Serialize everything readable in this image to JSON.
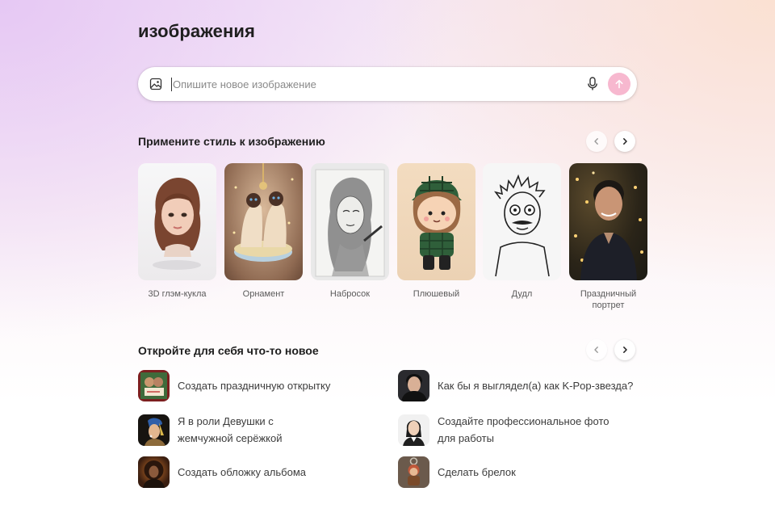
{
  "page": {
    "title": "изображения"
  },
  "prompt": {
    "placeholder": "Опишите новое изображение",
    "value": "",
    "icons": {
      "attach": "image-icon",
      "voice": "microphone-icon",
      "send": "arrow-up-icon"
    },
    "send_color": "#f7b8cf"
  },
  "styles_section": {
    "title": "Примените стиль к изображению",
    "prev": "chevron-left-icon",
    "next": "chevron-right-icon",
    "items": [
      {
        "label": "3D глэм-кукла"
      },
      {
        "label": "Орнамент"
      },
      {
        "label": "Набросок"
      },
      {
        "label": "Плюшевый"
      },
      {
        "label": "Дудл"
      },
      {
        "label": "Праздничный портрет"
      }
    ]
  },
  "discover_section": {
    "title": "Откройте для себя что-то новое",
    "prev": "chevron-left-icon",
    "next": "chevron-right-icon",
    "items": [
      {
        "label": "Создать праздничную открытку"
      },
      {
        "label": "Как бы я выглядел(а) как K-Pop-звезда?"
      },
      {
        "label": "Я в роли Девушки с жемчужной серёжкой"
      },
      {
        "label": "Создайте профессиональное фото для работы"
      },
      {
        "label": "Создать обложку альбома"
      },
      {
        "label": "Сделать брелок"
      }
    ]
  }
}
